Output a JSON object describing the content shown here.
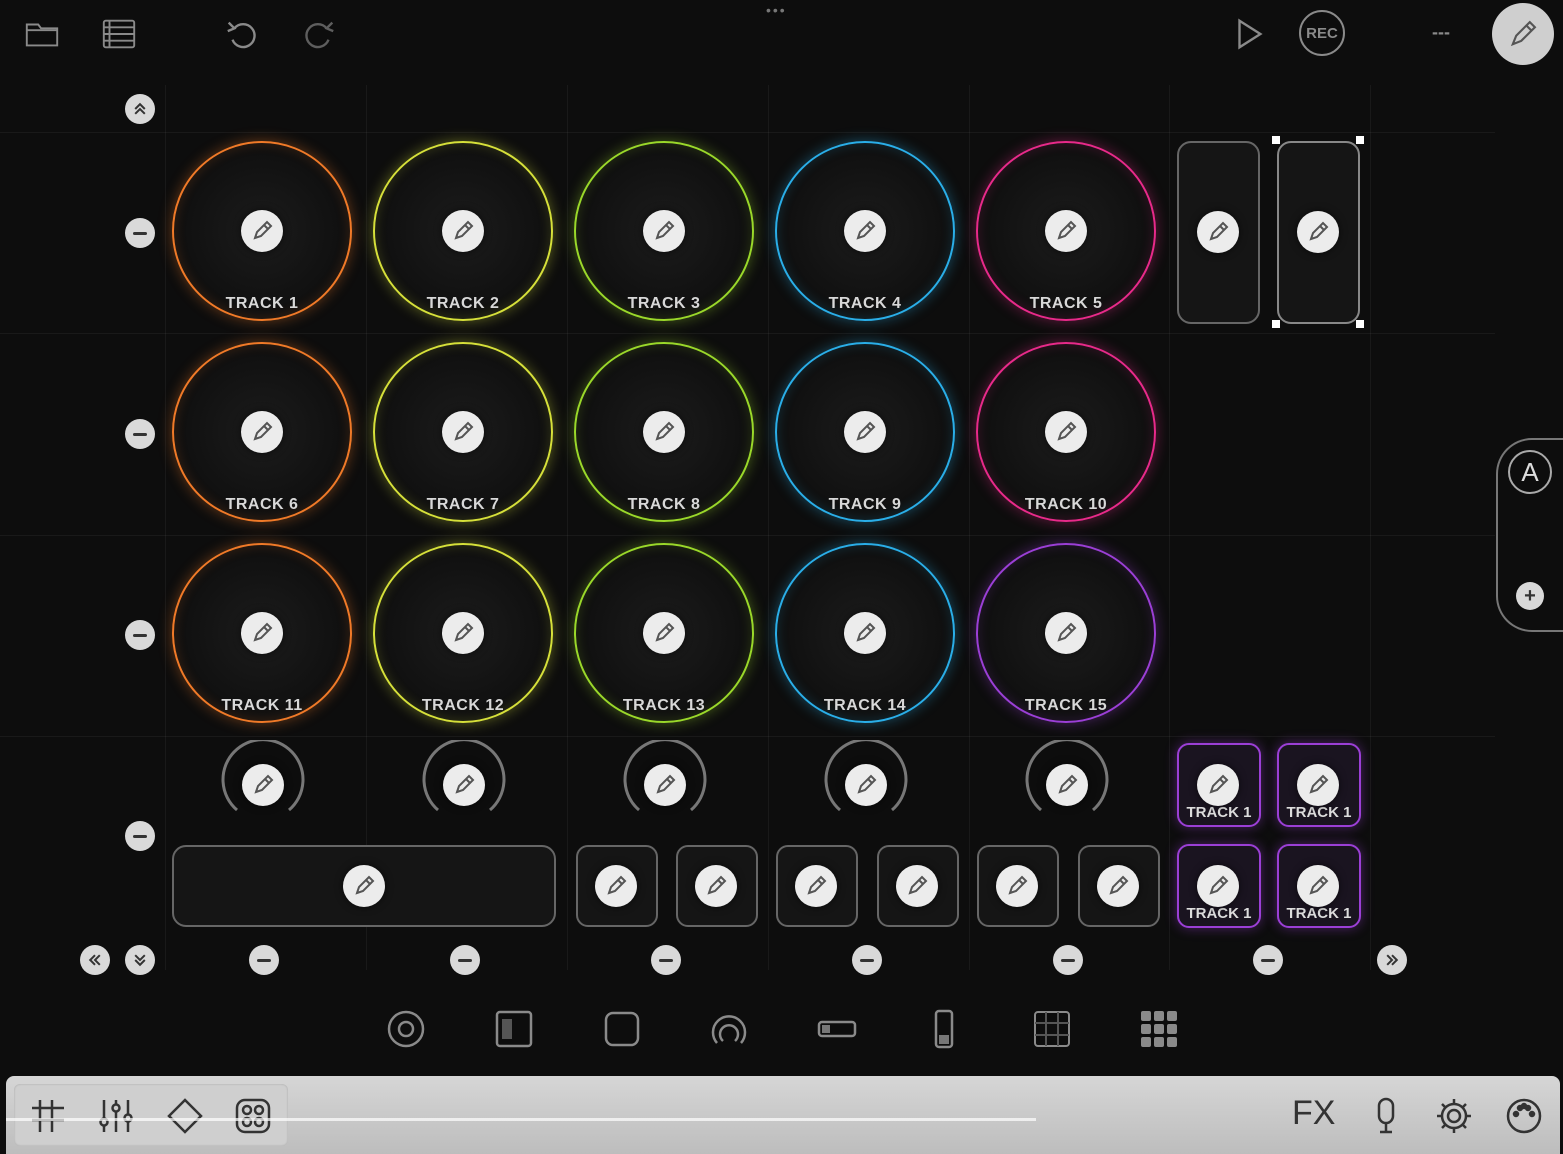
{
  "toolbar": {
    "rec_label": "REC",
    "more_label": "---"
  },
  "pads": [
    {
      "label": "TRACK 1",
      "color": "#f07a28"
    },
    {
      "label": "TRACK 2",
      "color": "#d6e03a"
    },
    {
      "label": "TRACK 3",
      "color": "#9ad82a"
    },
    {
      "label": "TRACK 4",
      "color": "#2aaee8"
    },
    {
      "label": "TRACK 5",
      "color": "#e82a8a"
    },
    {
      "label": "TRACK 6",
      "color": "#f07a28"
    },
    {
      "label": "TRACK 7",
      "color": "#d6e03a"
    },
    {
      "label": "TRACK 8",
      "color": "#9ad82a"
    },
    {
      "label": "TRACK 9",
      "color": "#2aaee8"
    },
    {
      "label": "TRACK 10",
      "color": "#e82a8a"
    },
    {
      "label": "TRACK 11",
      "color": "#f07a28"
    },
    {
      "label": "TRACK 12",
      "color": "#d6e03a"
    },
    {
      "label": "TRACK 13",
      "color": "#9ad82a"
    },
    {
      "label": "TRACK 14",
      "color": "#2aaee8"
    },
    {
      "label": "TRACK 15",
      "color": "#9b3fd6"
    }
  ],
  "small_pads": [
    "TRACK 1",
    "TRACK 1",
    "TRACK 1",
    "TRACK 1"
  ],
  "side_panel": {
    "letter": "A"
  },
  "bottom_bar": {
    "fx_label": "FX"
  }
}
